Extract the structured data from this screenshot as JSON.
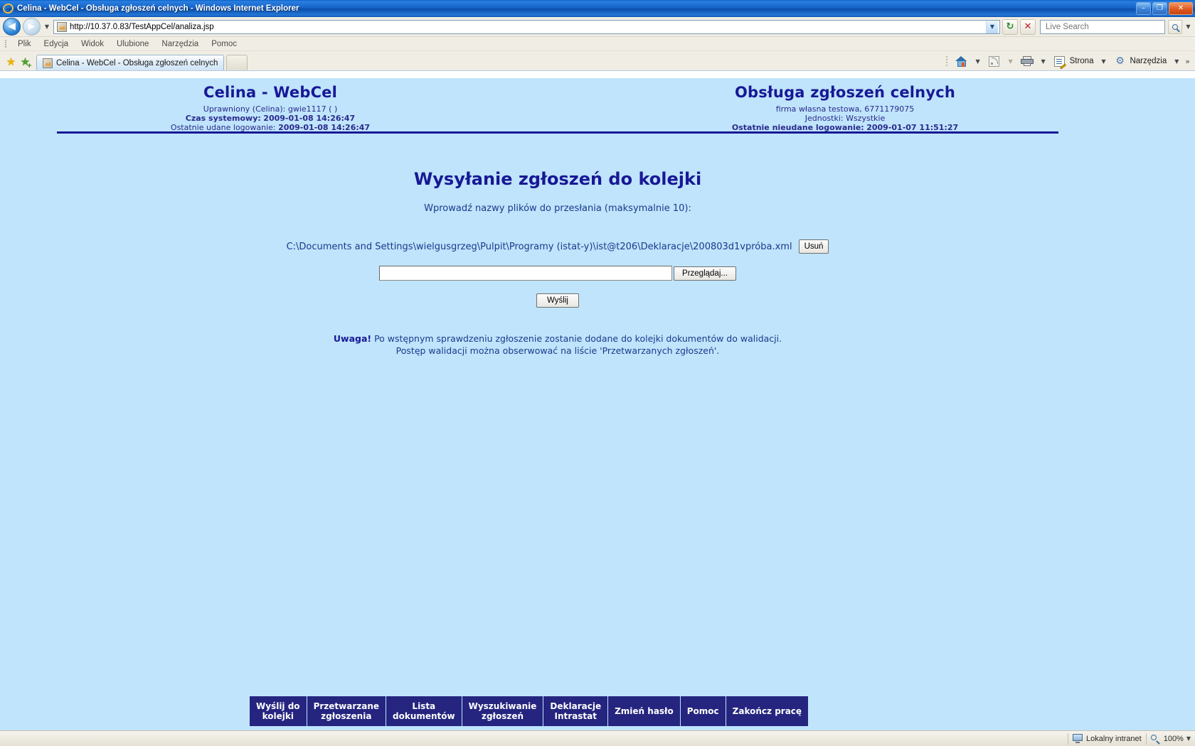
{
  "window": {
    "title": "Celina - WebCel - Obsługa zgłoszeń celnych - Windows Internet Explorer",
    "minimize_label": "–",
    "maximize_label": "❐",
    "close_label": "✕"
  },
  "address_bar": {
    "back_label": "◀",
    "forward_label": "▶",
    "history_caret": "▼",
    "url": "http://10.37.0.83/TestAppCel/analiza.jsp",
    "url_caret": "▼",
    "refresh_label": "↻",
    "stop_label": "✕",
    "search_placeholder": "Live Search",
    "search_value": "",
    "search_caret": "▼"
  },
  "menu": {
    "items": [
      {
        "label": "Plik"
      },
      {
        "label": "Edycja"
      },
      {
        "label": "Widok"
      },
      {
        "label": "Ulubione"
      },
      {
        "label": "Narzędzia"
      },
      {
        "label": "Pomoc"
      }
    ]
  },
  "tabbar": {
    "favorites_star": "★",
    "add_favorite_star": "★",
    "tabs": [
      {
        "label": "Celina - WebCel - Obsługa zgłoszeń celnych"
      }
    ],
    "new_tab_label": "",
    "home_caret": "▼",
    "feed_caret": "▼",
    "print_caret": "▼",
    "page_label": "Strona",
    "page_caret": "▼",
    "tools_label": "Narzędzia",
    "tools_caret": "▼",
    "overflow_chevrons": "»"
  },
  "page_header": {
    "left": {
      "title": "Celina - WebCel",
      "line1_label": "Uprawniony (Celina):",
      "line1_value": "gwie1117 ( )",
      "line2_label": "Czas systemowy:",
      "line2_value": "2009-01-08 14:26:47",
      "line3_label": "Ostatnie udane logowanie:",
      "line3_value": "2009-01-08 14:26:47"
    },
    "right": {
      "title": "Obsługa zgłoszeń celnych",
      "line1": "firma własna testowa, 6771179075",
      "line2_label": "Jednostki:",
      "line2_value": "Wszystkie",
      "line3_label": "Ostatnie nieudane logowanie:",
      "line3_value": "2009-01-07 11:51:27"
    }
  },
  "main": {
    "title": "Wysyłanie zgłoszeń do kolejki",
    "instruction": "Wprowadź nazwy plików do przesłania (maksymalnie 10):",
    "file_path": "C:\\Documents and Settings\\wielgusgrzeg\\Pulpit\\Programy (istat-y)\\ist@t206\\Deklaracje\\200803d1vpróba.xml",
    "remove_label": "Usuń",
    "file_input_value": "",
    "file_input_placeholder": "",
    "browse_label": "Przeglądaj...",
    "send_label": "Wyślij",
    "note_warning": "Uwaga!",
    "note_line1": " Po wstępnym sprawdzeniu zgłoszenie zostanie dodane do kolejki dokumentów do walidacji.",
    "note_line2": "Postęp walidacji można obserwować na liście 'Przetwarzanych zgłoszeń'."
  },
  "bottom_nav": {
    "items": [
      {
        "label": "Wyślij do\nkolejki"
      },
      {
        "label": "Przetwarzane\nzgłoszenia"
      },
      {
        "label": "Lista\ndokumentów"
      },
      {
        "label": "Wyszukiwanie\nzgłoszeń"
      },
      {
        "label": "Deklaracje\nIntrastat"
      },
      {
        "label": "Zmień hasło"
      },
      {
        "label": "Pomoc"
      },
      {
        "label": "Zakończ pracę"
      }
    ]
  },
  "status_bar": {
    "left_text": "",
    "zone_text": "Lokalny intranet",
    "zoom_text": "100%",
    "zoom_caret": "▼"
  },
  "colors": {
    "page_background": "#bfe4fb",
    "brand_text": "#181896",
    "nav_background": "#252580",
    "title_bar": "#1461c6"
  }
}
